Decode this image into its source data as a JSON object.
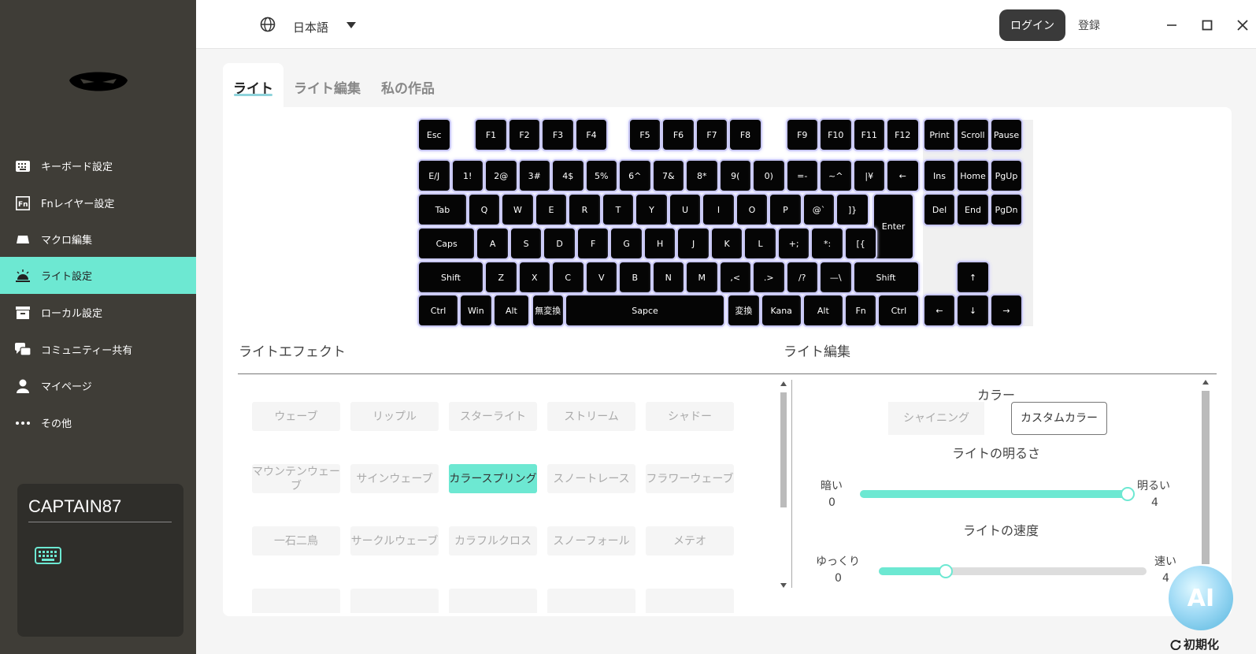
{
  "sidebar": {
    "items": [
      {
        "label": "キーボード設定",
        "icon": "keyboard-icon"
      },
      {
        "label": "Fnレイヤー設定",
        "icon": "fn-icon"
      },
      {
        "label": "マクロ編集",
        "icon": "macro-icon"
      },
      {
        "label": "ライト設定",
        "icon": "light-icon"
      },
      {
        "label": "ローカル設定",
        "icon": "local-icon"
      },
      {
        "label": "コミュニティー共有",
        "icon": "community-icon"
      },
      {
        "label": "マイページ",
        "icon": "user-icon"
      },
      {
        "label": "その他",
        "icon": "more-icon"
      }
    ],
    "active_index": 3,
    "device": {
      "name": "CAPTAIN87",
      "icon": "keyboard-icon"
    }
  },
  "topbar": {
    "language": "日本語",
    "login": "ログイン",
    "register": "登録"
  },
  "tabs": [
    {
      "label": "ライト"
    },
    {
      "label": "ライト編集"
    },
    {
      "label": "私の作品"
    }
  ],
  "keyboard": {
    "keys": [
      "Esc",
      "F1",
      "F2",
      "F3",
      "F4",
      "F5",
      "F6",
      "F7",
      "F8",
      "F9",
      "F10",
      "F11",
      "F12",
      "Print",
      "Scroll",
      "Pause",
      "E/J",
      "1!",
      "2@",
      "3#",
      "4$",
      "5%",
      "6^",
      "7&",
      "8*",
      "9(",
      "0)",
      "=-",
      "~^",
      "|¥",
      "←",
      "Ins",
      "Home",
      "PgUp",
      "Tab",
      "Q",
      "W",
      "E",
      "R",
      "T",
      "Y",
      "U",
      "I",
      "O",
      "P",
      "@`",
      "]}",
      "Enter",
      "Del",
      "End",
      "PgDn",
      "Caps",
      "A",
      "S",
      "D",
      "F",
      "G",
      "H",
      "J",
      "K",
      "L",
      "+;",
      "*:",
      "[{",
      "Shift",
      "Z",
      "X",
      "C",
      "V",
      "B",
      "N",
      "M",
      ",<",
      ".>",
      "/?",
      "—\\",
      "Shift",
      "↑",
      "Ctrl",
      "Win",
      "Alt",
      "無変換",
      "Sapce",
      "変換",
      "Kana",
      "Alt",
      "Fn",
      "Ctrl",
      "←",
      "↓",
      "→"
    ]
  },
  "effects": {
    "title": "ライトエフェクト",
    "items": [
      "ウェーブ",
      "リップル",
      "スターライト",
      "ストリーム",
      "シャドー",
      "マウンテンウェーブ",
      "サインウェーブ",
      "カラースプリング",
      "スノートレース",
      "フラワーウェーブ",
      "一石二鳥",
      "サークルウェーブ",
      "カラフルクロス",
      "スノーフォール",
      "メテオ"
    ],
    "active_index": 7
  },
  "light_edit": {
    "title": "ライト編集",
    "color_label": "カラー",
    "color_options": [
      "シャイニング",
      "カスタムカラー"
    ],
    "color_active_index": 1,
    "brightness": {
      "label": "ライトの明るさ",
      "min_label": "暗い",
      "max_label": "明るい",
      "min": "0",
      "max": "4",
      "value": 4
    },
    "speed": {
      "label": "ライトの速度",
      "min_label": "ゆっくり",
      "max_label": "速い",
      "min": "0",
      "max": "4",
      "value": 1
    }
  },
  "footer": {
    "reset": "初期化",
    "ai_badge": "AI"
  },
  "colors": {
    "sidebar": "#3f3d37",
    "accent": "#6de8d2",
    "key": "#050505",
    "key_glow": "#c9c8f4"
  }
}
